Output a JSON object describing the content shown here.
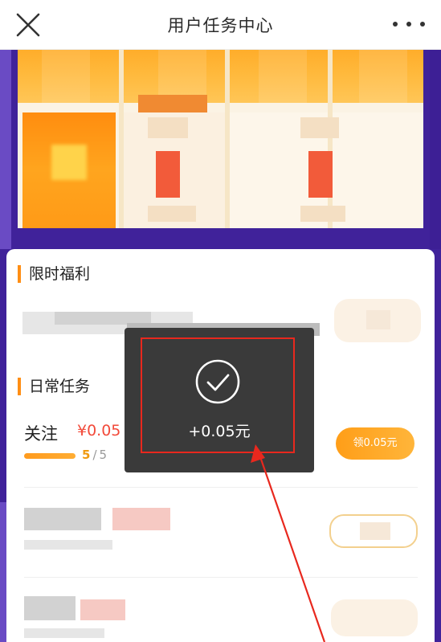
{
  "navbar": {
    "title": "用户任务中心",
    "close_icon": "close-icon",
    "more_icon": "more-dots-icon"
  },
  "sections": {
    "limited_title": "限时福利",
    "daily_title": "日常任务"
  },
  "daily_task": {
    "name": "关注",
    "reward": "¥0.05",
    "progress_done": "5",
    "progress_sep": "/",
    "progress_total": "5",
    "progress_fraction": 1.0,
    "claim_label": "领0.05元"
  },
  "toast": {
    "icon": "check-circle-icon",
    "text": "+0.05元"
  },
  "colors": {
    "accent_orange": "#ff9e18",
    "reward_red": "#f24a3a",
    "annotation_red": "#e8281e",
    "background_purple": "#40229a"
  }
}
